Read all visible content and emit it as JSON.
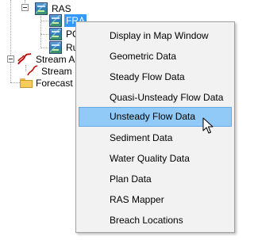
{
  "tree": {
    "ras_label": "RAS",
    "plan_fra": "FRA",
    "plan_po": "PO",
    "plan_ru": "Ru",
    "stream_label": "Stream A",
    "stream_child": "Stream",
    "forecast_label": "Forecast I"
  },
  "menu": {
    "items": [
      "Display in Map Window",
      "Geometric Data",
      "Steady Flow Data",
      "Quasi-Unsteady Flow Data",
      "Unsteady Flow Data",
      "Sediment Data",
      "Water Quality Data",
      "Plan Data",
      "RAS Mapper",
      "Breach Locations"
    ],
    "hovered_item": "Unsteady Flow Data"
  },
  "colors": {
    "selection": "#3399ff",
    "menu_hover": "#91c9f7",
    "menu_background": "#f2f2f2"
  }
}
